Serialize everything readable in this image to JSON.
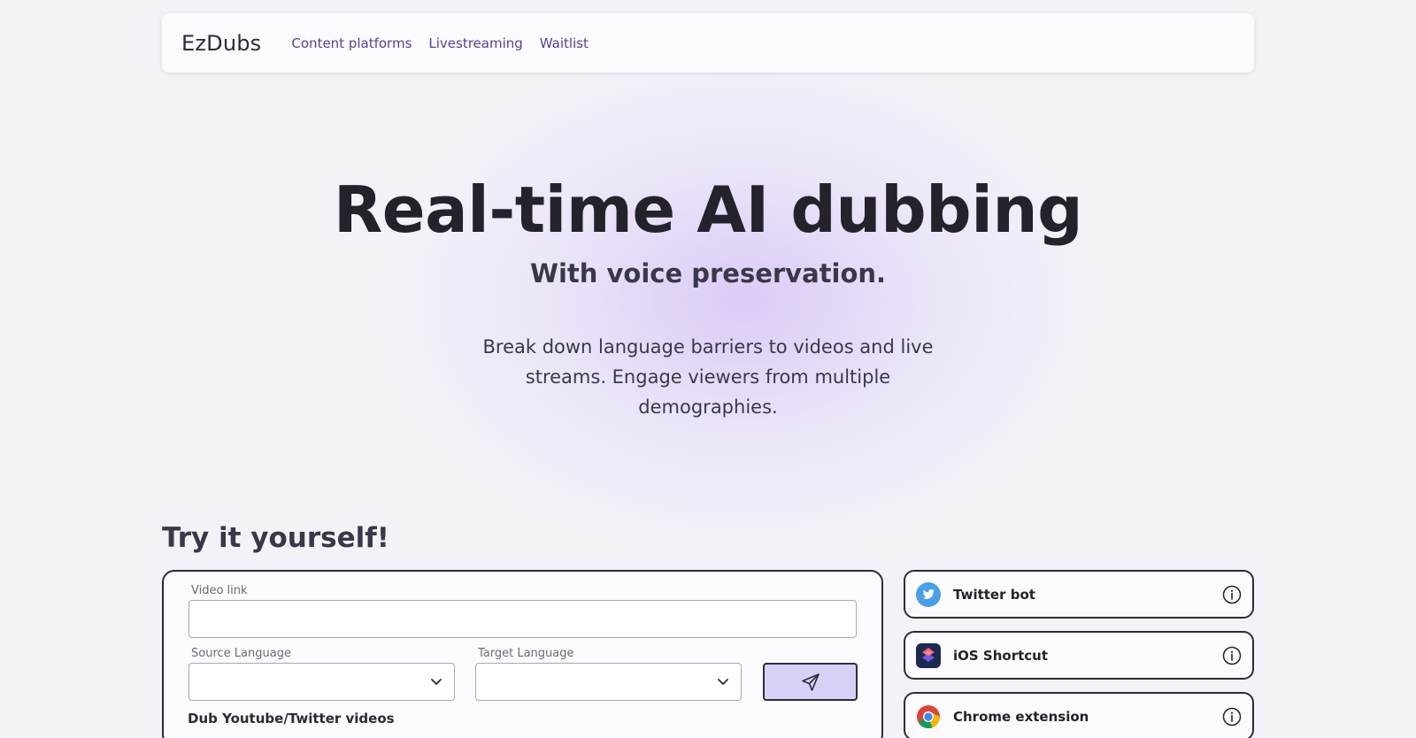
{
  "nav": {
    "brand": "EzDubs",
    "links": [
      "Content platforms",
      "Livestreaming",
      "Waitlist"
    ]
  },
  "hero": {
    "title": "Real-time AI dubbing",
    "subtitle": "With voice preservation.",
    "description": "Break down language barriers to videos and live streams. Engage viewers from multiple demographies."
  },
  "try_section": {
    "heading": "Try it yourself!",
    "video_link_label": "Video link",
    "video_link_value": "",
    "source_language_label": "Source Language",
    "source_language_value": "",
    "target_language_label": "Target Language",
    "target_language_value": "",
    "submit_icon": "send-icon",
    "caption": "Dub Youtube/Twitter videos"
  },
  "integrations": [
    {
      "label": "Twitter bot",
      "icon": "twitter-icon"
    },
    {
      "label": "iOS Shortcut",
      "icon": "shortcuts-icon"
    },
    {
      "label": "Chrome extension",
      "icon": "chrome-icon"
    }
  ],
  "colors": {
    "accent_purple": "#5b3f92",
    "button_fill": "#d8d0f5",
    "border_dark": "#2e2c3a",
    "twitter_blue": "#4a9fe8"
  }
}
